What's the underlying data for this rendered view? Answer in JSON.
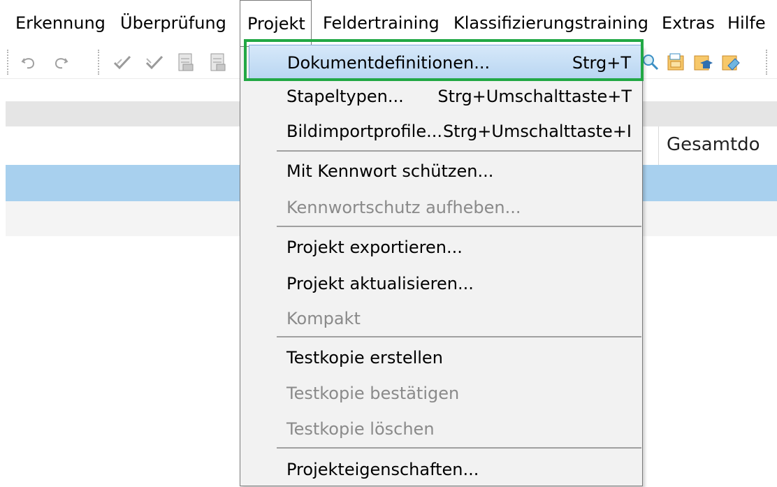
{
  "menubar": {
    "items": [
      "Erkennung",
      "Überprüfung",
      "Projekt",
      "Feldertraining",
      "Klassifizierungstraining",
      "Extras",
      "Hilfe"
    ]
  },
  "toolbar": {
    "icons": [
      "undo-icon",
      "redo-icon",
      "check-icon",
      "check-all-icon",
      "document-icon",
      "document-list-icon",
      "search-document-icon",
      "folder-icon",
      "training-icon",
      "tag-icon"
    ]
  },
  "table": {
    "column_header": "Gesamtdo"
  },
  "project_menu": {
    "items": [
      {
        "label": "Dokumentdefinitionen...",
        "shortcut": "Strg+T"
      },
      {
        "label": "Stapeltypen...",
        "shortcut": "Strg+Umschalttaste+T"
      },
      {
        "label": "Bildimportprofile...",
        "shortcut": "Strg+Umschalttaste+I"
      },
      {
        "label": "Mit Kennwort schützen...",
        "shortcut": ""
      },
      {
        "label": "Kennwortschutz aufheben...",
        "shortcut": ""
      },
      {
        "label": "Projekt exportieren...",
        "shortcut": ""
      },
      {
        "label": "Projekt aktualisieren...",
        "shortcut": ""
      },
      {
        "label": "Kompakt",
        "shortcut": ""
      },
      {
        "label": "Testkopie erstellen",
        "shortcut": ""
      },
      {
        "label": "Testkopie bestätigen",
        "shortcut": ""
      },
      {
        "label": "Testkopie löschen",
        "shortcut": ""
      },
      {
        "label": "Projekteigenschaften...",
        "shortcut": ""
      }
    ]
  },
  "colors": {
    "highlight_box": "#22a845",
    "selected_row": "#a8d0ee",
    "disabled_text": "#8a8a8a"
  }
}
